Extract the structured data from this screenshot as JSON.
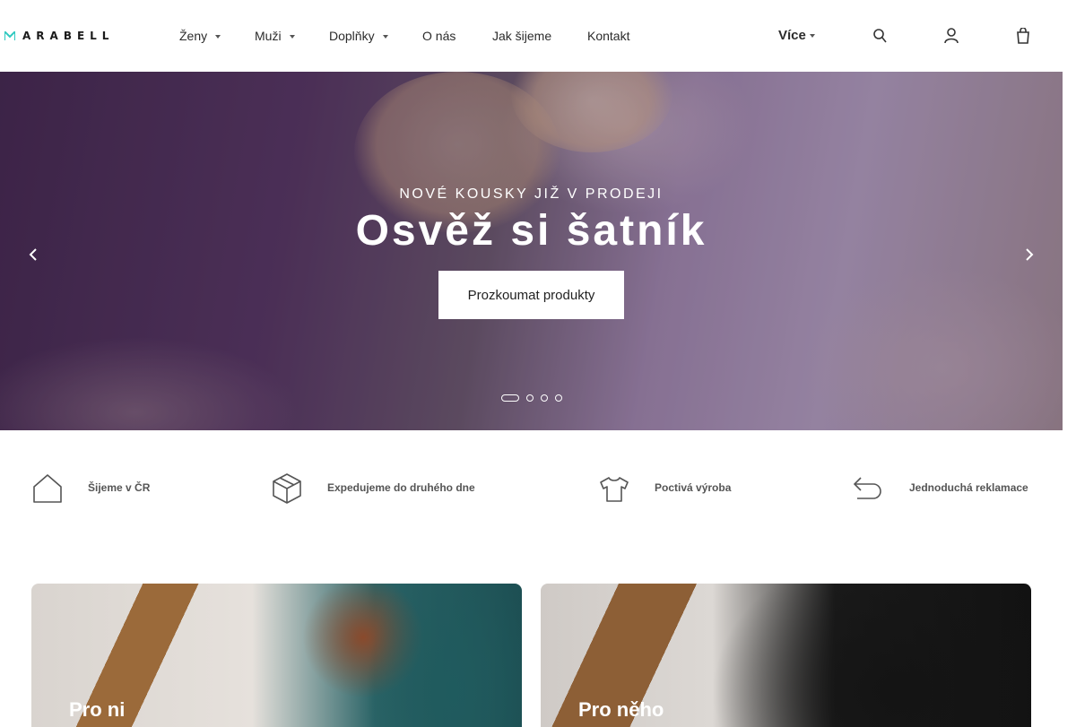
{
  "header": {
    "logo_text": "ARABELL",
    "nav": [
      {
        "label": "Ženy",
        "has_dropdown": true
      },
      {
        "label": "Muži",
        "has_dropdown": true
      },
      {
        "label": "Doplňky",
        "has_dropdown": true
      },
      {
        "label": "O nás",
        "has_dropdown": false
      },
      {
        "label": "Jak šijeme",
        "has_dropdown": false
      },
      {
        "label": "Kontakt",
        "has_dropdown": false
      }
    ],
    "more_label": "Více",
    "icons": [
      "search-icon",
      "account-icon",
      "cart-icon"
    ]
  },
  "hero": {
    "kicker": "NOVÉ KOUSKY JIŽ V PRODEJI",
    "title": "Osvěž si šatník",
    "cta_label": "Prozkoumat produkty",
    "slides_count": 4,
    "active_slide": 1
  },
  "features": [
    {
      "label": "Šijeme v ČR",
      "icon": "house-icon"
    },
    {
      "label": "Expedujeme do druhého dne",
      "icon": "package-icon"
    },
    {
      "label": "Poctivá výroba",
      "icon": "tshirt-icon"
    },
    {
      "label": "Jednoduchá reklamace",
      "icon": "return-arrow-icon"
    }
  ],
  "categories": [
    {
      "title": "Pro ni"
    },
    {
      "title": "Pro něho"
    }
  ],
  "colors": {
    "accent": "#2fc9c0",
    "text": "#2b2b2b",
    "muted": "#555555"
  }
}
